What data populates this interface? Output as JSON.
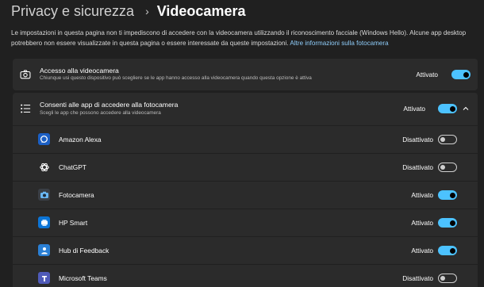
{
  "header": {
    "breadcrumb_parent": "Privacy e sicurezza",
    "separator": "›",
    "page_title": "Videocamera"
  },
  "description": {
    "text": "Le impostazioni in questa pagina non ti impediscono di accedere con la videocamera utilizzando il riconoscimento facciale (Windows Hello). Alcune app desktop potrebbero non essere visualizzate in questa pagina o essere interessate da queste impostazioni.",
    "link": "Altre informazioni sulla fotocamera"
  },
  "camera_access": {
    "icon": "camera-icon",
    "title": "Accesso alla videocamera",
    "subtitle": "Chiunque usi questo dispositivo può scegliere se le app hanno accesso alla videocamera quando questa opzione è attiva",
    "state": "Attivato",
    "on": true
  },
  "app_access": {
    "icon": "list-icon",
    "title": "Consenti alle app di accedere alla fotocamera",
    "subtitle": "Scegli le app che possono accedere alla videocamera",
    "state": "Attivato",
    "on": true,
    "expanded": true
  },
  "apps": [
    {
      "name": "Amazon Alexa",
      "state": "Disattivato",
      "on": false,
      "icon": "alexa-icon",
      "color": "#1b5fc4"
    },
    {
      "name": "ChatGPT",
      "state": "Disattivato",
      "on": false,
      "icon": "chatgpt-icon",
      "color": "#2b2b2b"
    },
    {
      "name": "Fotocamera",
      "state": "Attivato",
      "on": true,
      "icon": "camera-app-icon",
      "color": "#3a3f46"
    },
    {
      "name": "HP Smart",
      "state": "Attivato",
      "on": true,
      "icon": "hp-smart-icon",
      "color": "#0b74d6"
    },
    {
      "name": "Hub di Feedback",
      "state": "Attivato",
      "on": true,
      "icon": "feedback-hub-icon",
      "color": "#2a7fd4"
    },
    {
      "name": "Microsoft Teams",
      "state": "Disattivato",
      "on": false,
      "icon": "teams-icon",
      "color": "#4f5ab8"
    }
  ],
  "colors": {
    "background": "#202020",
    "card": "#2b2b2b",
    "accent": "#4cc2ff",
    "link": "#8fcdfa"
  }
}
